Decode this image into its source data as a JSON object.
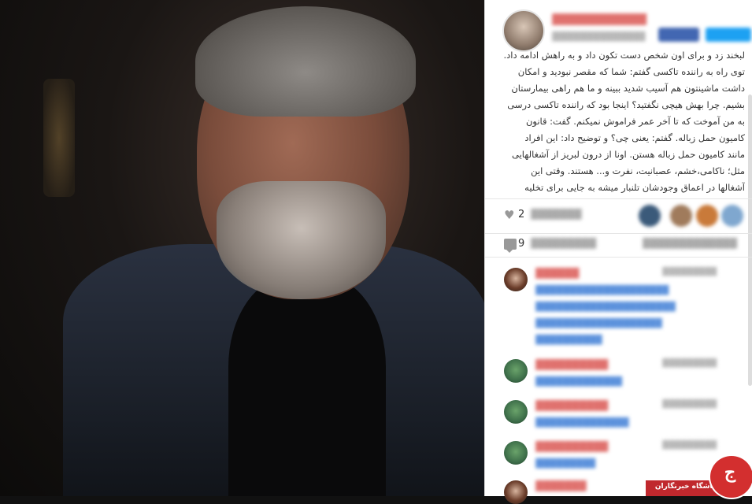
{
  "post": {
    "likes_count": "2",
    "comments_count": "9",
    "caption_lines": [
      "لبخند زد و برای اون شخص دست تکون داد و به راهش ادامه داد.",
      "توی راه به راننده تاکسی گفتم: شما که مقصر نبودید و امکان",
      "داشت ماشینتون هم آسیب شدید ببینه و ما هم راهی بیمارستان",
      "بشیم. چرا بهش هیچی نگفتید؟ اینجا بود که راننده تاکسی درسی",
      "به من آموخت که تا آخر عمر فراموش نمیکنم. گفت: قانون",
      "کامیون حمل زباله. گفتم: یعنی چی؟ و توضیح داد: این افراد",
      "مانند کامیون حمل زباله هستن. اونا از درون لبریز از آشغالهایی",
      "مثل؛ ناکامی،خشم، عصبانیت، نفرت و... هستند. وقتی این",
      "آشغالها در اعماق وجودشان تلنبار میشه به جایی برای تخلیه"
    ]
  },
  "watermark": {
    "text": "باشگاه خبرنگاران",
    "logo": "ج"
  },
  "icons": {
    "like": "heart-icon",
    "comment": "speech-bubble-icon"
  },
  "colors": {
    "username": "#d9534f",
    "mention": "#3a7bd5",
    "brand_red": "#c0282d"
  }
}
